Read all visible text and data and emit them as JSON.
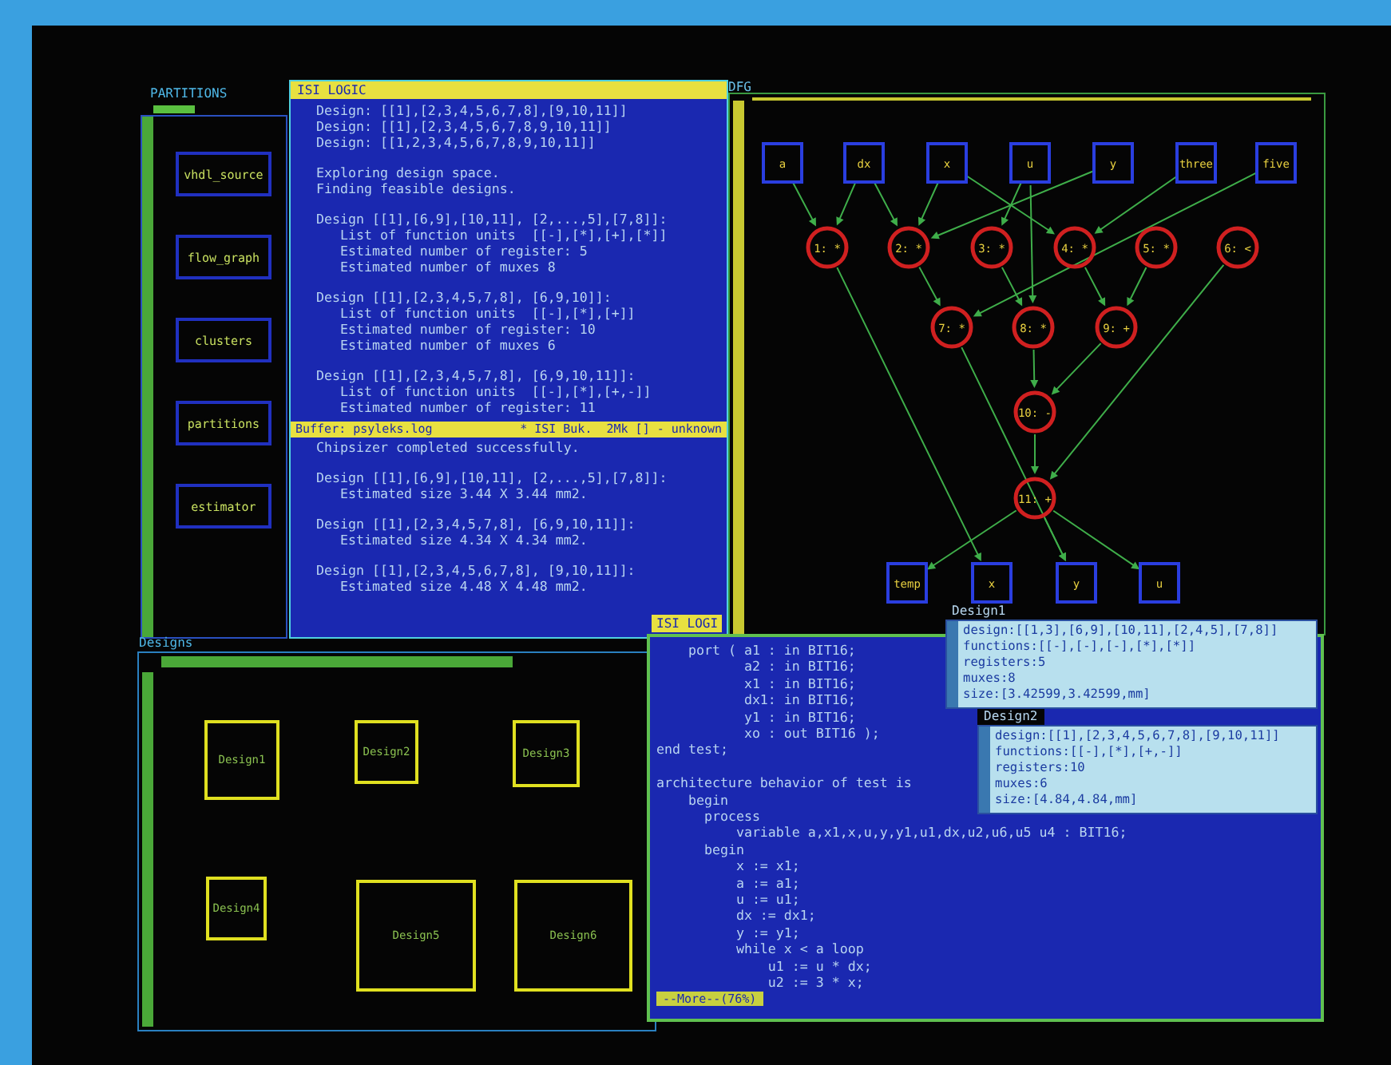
{
  "partitions": {
    "title": "PARTITIONS",
    "buttons": [
      "vhdl_source",
      "flow_graph",
      "clusters",
      "partitions",
      "estimator"
    ]
  },
  "log_window": {
    "title": "ISI LOGIC",
    "paragraphs": [
      [
        "Design: [[1],[2,3,4,5,6,7,8],[9,10,11]]",
        "Design: [[1],[2,3,4,5,6,7,8,9,10,11]]",
        "Design: [[1,2,3,4,5,6,7,8,9,10,11]]"
      ],
      [
        "Exploring design space.",
        "Finding feasible designs."
      ],
      [
        "Design [[1],[6,9],[10,11], [2,...,5],[7,8]]:",
        "   List of function units  [[-],[*],[+],[*]]",
        "   Estimated number of register: 5",
        "   Estimated number of muxes 8"
      ],
      [
        "Design [[1],[2,3,4,5,7,8], [6,9,10]]:",
        "   List of function units  [[-],[*],[+]]",
        "   Estimated number of register: 10",
        "   Estimated number of muxes 6"
      ],
      [
        "Design [[1],[2,3,4,5,7,8], [6,9,10,11]]:",
        "   List of function units  [[-],[*],[+,-]]",
        "   Estimated number of register: 11"
      ]
    ],
    "status_bar": {
      "buffer": "Buffer: psyleks.log",
      "info": "* ISI Buk.  2Mk [] - unknown"
    },
    "output_paragraphs": [
      [
        "Chipsizer completed successfully."
      ],
      [
        "Design [[1],[6,9],[10,11], [2,...,5],[7,8]]:",
        "   Estimated size 3.44 X 3.44 mm2."
      ],
      [
        "Design [[1],[2,3,4,5,7,8], [6,9,10,11]]:",
        "   Estimated size 4.34 X 4.34 mm2."
      ],
      [
        "Design [[1],[2,3,4,5,6,7,8], [9,10,11]]:",
        "   Estimated size 4.48 X 4.48 mm2."
      ]
    ]
  },
  "dfg_window": {
    "title": "DFG",
    "inputs": [
      "a",
      "dx",
      "x",
      "u",
      "y",
      "three",
      "five"
    ],
    "operations": [
      [
        "1: *",
        "2: *",
        "3: *",
        "4: *",
        "5: *",
        "6: <"
      ],
      [
        "7: *",
        "8: *",
        "9: +"
      ],
      [
        "10: -"
      ],
      [
        "11: +"
      ]
    ],
    "outputs": [
      "temp",
      "x",
      "y",
      "u"
    ]
  },
  "designs_window": {
    "title": "Designs",
    "designs": [
      "Design1",
      "Design2",
      "Design3",
      "Design4",
      "Design5",
      "Design6"
    ]
  },
  "editor_window": {
    "title": "ISI LOGI",
    "paragraphs": [
      [
        "    port ( a1 : in BIT16;",
        "           a2 : in BIT16;",
        "           x1 : in BIT16;",
        "           dx1: in BIT16;",
        "           y1 : in BIT16;",
        "           xo : out BIT16 );",
        "end test;"
      ],
      [
        "architecture behavior of test is",
        "    begin",
        "      process",
        "          variable a,x1,x,u,y,y1,u1,dx,u2,u6,u5 u4 : BIT16;",
        "      begin",
        "          x := x1;",
        "          a := a1;",
        "          u := u1;",
        "          dx := dx1;",
        "          y := y1;",
        "          while x < a loop",
        "              u1 := u * dx;",
        "              u2 := 3 * x;"
      ]
    ],
    "mode_line": "--More--(76%)"
  },
  "popups": [
    {
      "title": "Design1",
      "lines": [
        "design:[[1,3],[6,9],[10,11],[2,4,5],[7,8]]",
        "functions:[[-],[-],[-],[*],[*]]",
        "registers:5",
        "muxes:8",
        "size:[3.42599,3.42599,mm]"
      ]
    },
    {
      "title": "Design2",
      "lines": [
        "design:[[1],[2,3,4,5,6,7,8],[9,10,11]]",
        "functions:[[-],[*],[+,-]]",
        "registers:10",
        "muxes:6",
        "size:[4.84,4.84,mm]"
      ]
    }
  ]
}
